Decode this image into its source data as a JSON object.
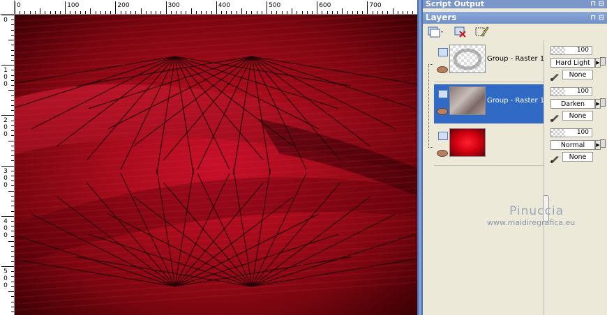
{
  "ruler": {
    "top_labels": [
      "0",
      "100",
      "200",
      "300",
      "400",
      "500",
      "600",
      "700"
    ],
    "left_labels": [
      [
        "0"
      ],
      [
        "1",
        "0",
        "0"
      ],
      [
        "2",
        "0",
        "0"
      ],
      [
        "3",
        "0",
        "0"
      ],
      [
        "4",
        "0",
        "0"
      ],
      [
        "5",
        "0",
        "0"
      ]
    ]
  },
  "script_output": {
    "title": "Script Output"
  },
  "layers_palette": {
    "title": "Layers",
    "title_buttons": "⊓ ⊟"
  },
  "layers": [
    {
      "name": "Group - Raster 1",
      "opacity": "100",
      "blend_mode": "Hard Light",
      "mask": "None",
      "thumb": "transparent-texture",
      "selected": false
    },
    {
      "name": "Group - Raster 1",
      "opacity": "100",
      "blend_mode": "Darken",
      "mask": "None",
      "thumb": "stone-texture",
      "selected": true
    },
    {
      "name": "",
      "opacity": "100",
      "blend_mode": "Normal",
      "mask": "None",
      "thumb": "red-gradient",
      "selected": false
    }
  ],
  "watermark": {
    "name": "Pinuccia",
    "url": "www.maidiregrafica.eu"
  },
  "colors": {
    "selection": "#316ac5",
    "canvas_red": "#c8102a",
    "canvas_dark": "#3a0004"
  }
}
